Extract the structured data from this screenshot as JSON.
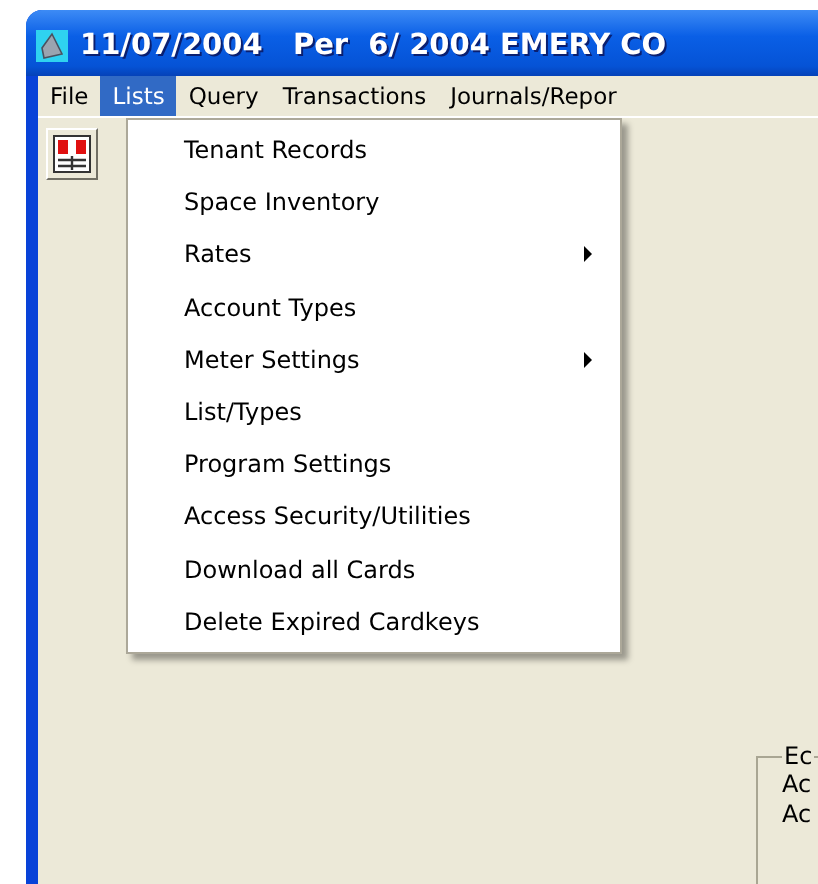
{
  "window": {
    "title": "11/07/2004   Per  6/ 2004 EMERY CO"
  },
  "menu_bar": [
    {
      "label": "File",
      "selected": false
    },
    {
      "label": "Lists",
      "selected": true
    },
    {
      "label": "Query",
      "selected": false
    },
    {
      "label": "Transactions",
      "selected": false
    },
    {
      "label": "Journals/Repor",
      "selected": false
    }
  ],
  "dropdown": {
    "items": [
      {
        "label": "Tenant Records",
        "submenu": false
      },
      {
        "label": "Space Inventory",
        "submenu": false
      },
      {
        "label": "Rates",
        "submenu": true
      },
      {
        "label": "Account Types",
        "submenu": false
      },
      {
        "label": "Meter Settings",
        "submenu": true
      },
      {
        "label": "List/Types",
        "submenu": false
      },
      {
        "label": "Program Settings",
        "submenu": false
      },
      {
        "label": "Access Security/Utilities",
        "submenu": false
      },
      {
        "label": "Download all Cards",
        "submenu": false
      },
      {
        "label": "Delete Expired Cardkeys",
        "submenu": false
      }
    ]
  },
  "group_box": {
    "title": "Ec",
    "lines": [
      "Ac",
      "Ac"
    ]
  }
}
